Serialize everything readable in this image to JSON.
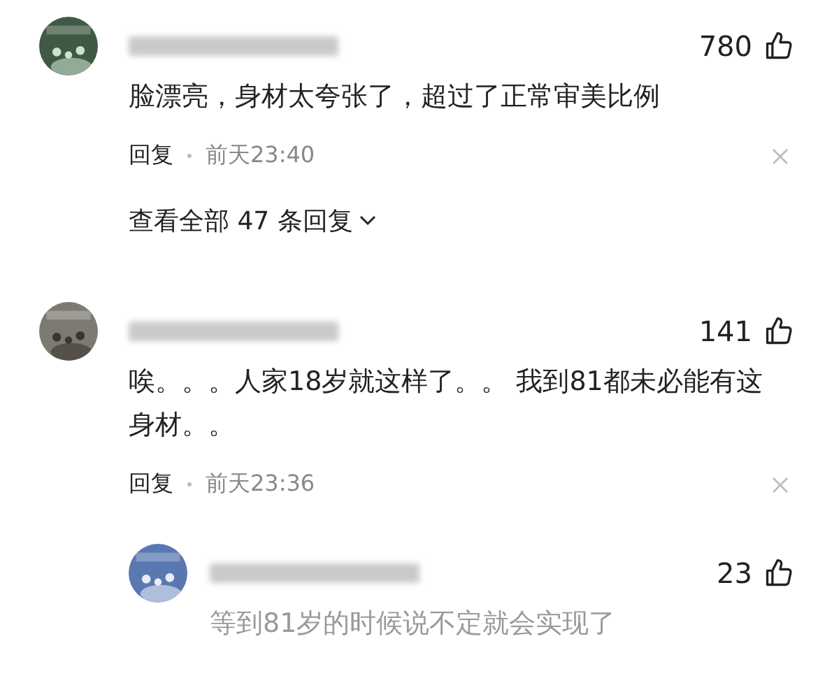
{
  "comments": [
    {
      "likes": "780",
      "text": "脸漂亮，身材太夸张了，超过了正常审美比例",
      "reply_label": "回复",
      "time": "前天23:40",
      "view_replies": "查看全部 47 条回复"
    },
    {
      "likes": "141",
      "text": "唉。。。人家18岁就这样了。。 我到81都未必能有这身材。。",
      "reply_label": "回复",
      "time": "前天23:36",
      "replies": [
        {
          "likes": "23",
          "text": "等到81岁的时候说不定就会实现了"
        }
      ]
    }
  ]
}
